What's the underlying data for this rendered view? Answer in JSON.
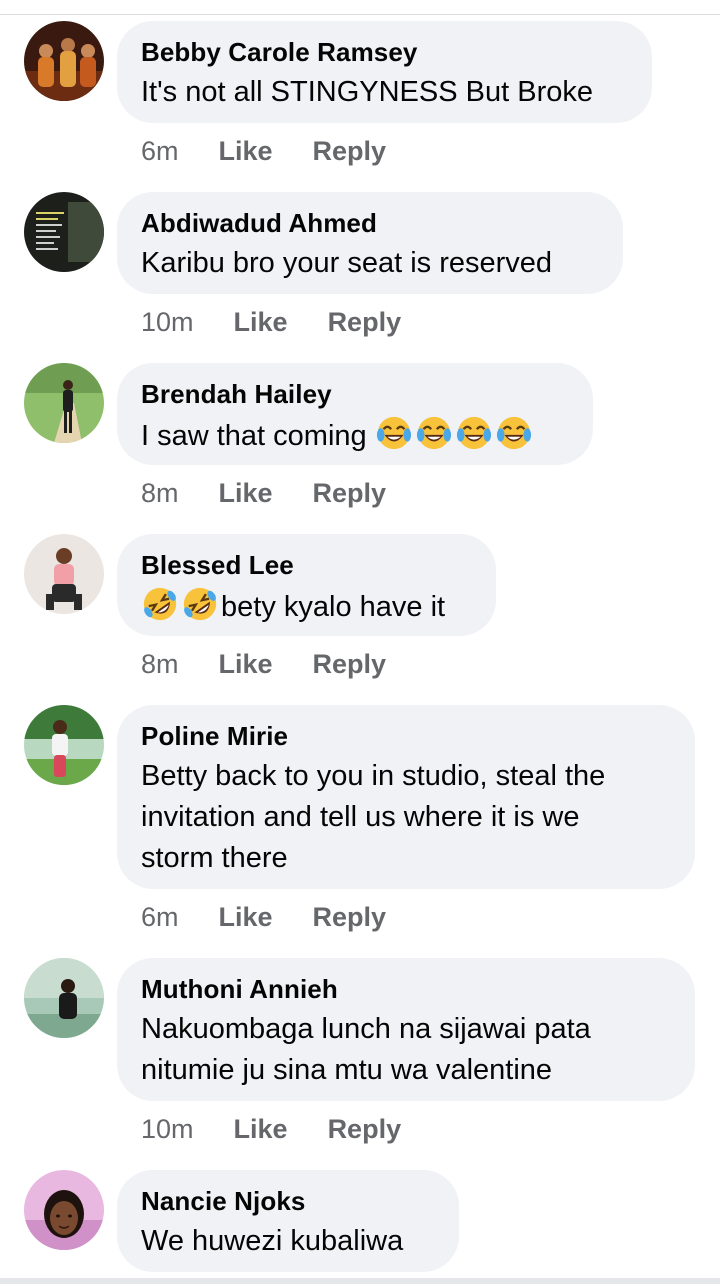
{
  "comments": [
    {
      "author": "Bebby Carole Ramsey",
      "text": "It's not all STINGYNESS But Broke",
      "time": "6m"
    },
    {
      "author": "Abdiwadud Ahmed",
      "text": "Karibu bro your seat is reserved",
      "time": "10m"
    },
    {
      "author": "Brendah Hailey",
      "text": "I saw that coming ",
      "emoji_after": "face-with-tears-of-joy-icon",
      "emoji_count": 4,
      "time": "8m"
    },
    {
      "author": "Blessed Lee",
      "text": "bety kyalo have it",
      "emoji_before": "rolling-on-floor-laughing-icon",
      "emoji_count": 2,
      "time": "8m"
    },
    {
      "author": "Poline Mirie",
      "lines": [
        "Betty back to you in studio, steal the",
        "invitation and tell us where it is we",
        "storm there"
      ],
      "time": "6m"
    },
    {
      "author": "Muthoni Annieh",
      "lines": [
        "Nakuombaga lunch na sijawai pata",
        "nitumie ju sina mtu wa valentine"
      ],
      "time": "10m"
    },
    {
      "author": "Nancie Njoks",
      "text": "We huwezi kubaliwa"
    }
  ],
  "actions": {
    "like_label": "Like",
    "reply_label": "Reply"
  },
  "colors": {
    "bubble": "#f0f2f5",
    "meta_text": "#65676b",
    "emoji_face": "#f8c23a"
  }
}
